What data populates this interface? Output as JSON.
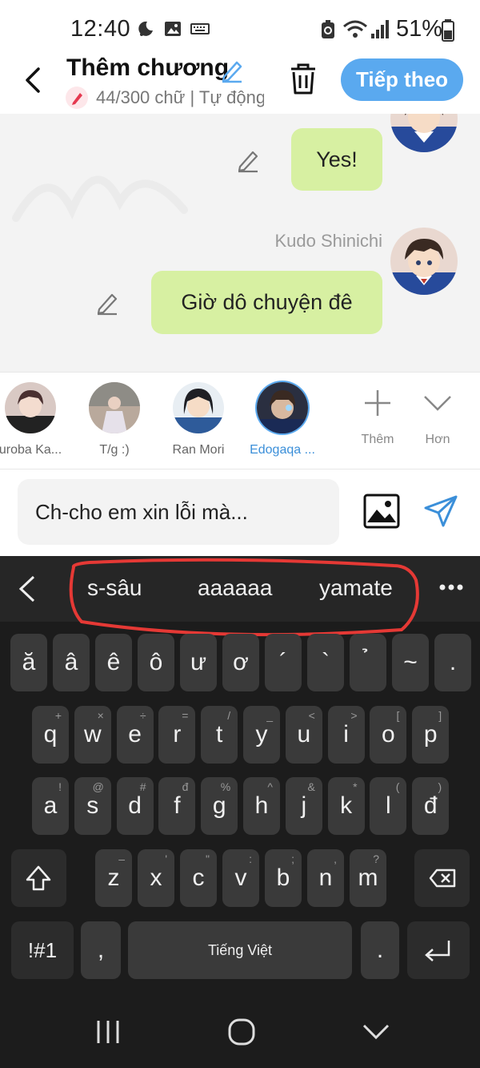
{
  "status_bar": {
    "time": "12:40",
    "battery": "51%"
  },
  "header": {
    "title": "Thêm chương",
    "subtitle": "44/300 chữ | Tự động",
    "next_label": "Tiếp theo"
  },
  "chat": {
    "messages": [
      {
        "text": "Yes!",
        "sender": ""
      },
      {
        "text": "Giờ dô chuyện đê",
        "sender": "Kudo Shinichi"
      }
    ]
  },
  "characters": [
    {
      "name": "uroba Ka...",
      "active": false
    },
    {
      "name": "T/g :)",
      "active": false
    },
    {
      "name": "Ran Mori",
      "active": false
    },
    {
      "name": "Edogaqa ...",
      "active": true
    }
  ],
  "actions": {
    "add_label": "Thêm",
    "more_label": "Hơn"
  },
  "composer": {
    "input_value": "Ch-cho em xin lỗi mà..."
  },
  "keyboard": {
    "suggestions": [
      "s-sâu",
      "aaaaaa",
      "yamate"
    ],
    "row_accents": [
      "ă",
      "â",
      "ê",
      "ô",
      "ư",
      "ơ",
      "´",
      "`",
      "̉",
      "~",
      "."
    ],
    "row1": [
      [
        "q",
        "+"
      ],
      [
        "w",
        "×"
      ],
      [
        "e",
        "÷"
      ],
      [
        "r",
        "="
      ],
      [
        "t",
        "/"
      ],
      [
        "y",
        "_"
      ],
      [
        "u",
        "<"
      ],
      [
        "i",
        ">"
      ],
      [
        "o",
        "["
      ],
      [
        "p",
        "]"
      ]
    ],
    "row2": [
      [
        "a",
        "!"
      ],
      [
        "s",
        "@"
      ],
      [
        "d",
        "#"
      ],
      [
        "f",
        "đ"
      ],
      [
        "g",
        "%"
      ],
      [
        "h",
        "^"
      ],
      [
        "j",
        "&"
      ],
      [
        "k",
        "*"
      ],
      [
        "l",
        "("
      ],
      [
        "đ",
        ")"
      ]
    ],
    "row3": [
      [
        "z",
        "–"
      ],
      [
        "x",
        "'"
      ],
      [
        "c",
        "\""
      ],
      [
        "v",
        ":"
      ],
      [
        "b",
        ";"
      ],
      [
        "n",
        ","
      ],
      [
        "m",
        "?"
      ]
    ],
    "symbols_label": "!#1",
    "comma_label": ",",
    "space_label": "Tiếng Việt",
    "period_label": "."
  },
  "colors": {
    "accent": "#5aa9ef",
    "bubble": "#d7f0a2",
    "annotation": "#e53935"
  }
}
